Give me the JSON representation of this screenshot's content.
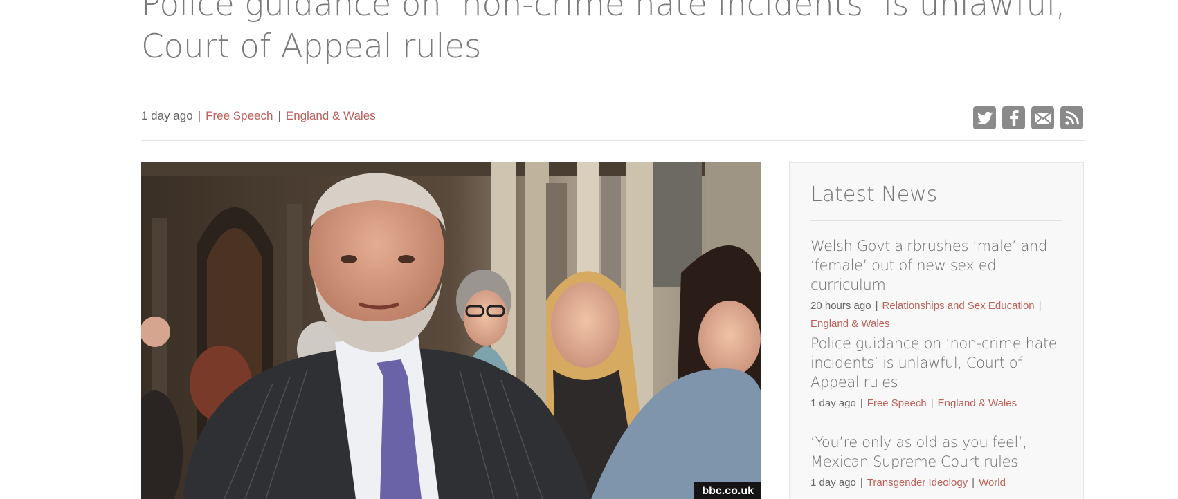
{
  "article": {
    "title": "Police guidance on ‘non-crime hate incidents’ is unlawful, Court of Appeal rules",
    "age": "1 day ago",
    "tags": [
      "Free Speech",
      "England & Wales"
    ],
    "separator": "|"
  },
  "share": {
    "buttons": [
      "twitter-icon",
      "facebook-icon",
      "email-icon",
      "rss-icon"
    ],
    "color": "#8a8a8a"
  },
  "hero_image": {
    "credit": "bbc.co.uk"
  },
  "sidebar": {
    "heading": "Latest News",
    "items": [
      {
        "title": "Welsh Govt airbrushes ‘male’ and ‘female’ out of new sex ed curriculum",
        "age": "20 hours ago",
        "tags": [
          "Relationships and Sex Education",
          "England & Wales"
        ]
      },
      {
        "title": "Police guidance on ‘non-crime hate incidents’ is unlawful, Court of Appeal rules",
        "age": "1 day ago",
        "tags": [
          "Free Speech",
          "England & Wales"
        ]
      },
      {
        "title": "‘You’re only as old as you feel’, Mexican Supreme Court rules",
        "age": "1 day ago",
        "tags": [
          "Transgender Ideology",
          "World"
        ]
      }
    ]
  },
  "colors": {
    "link": "#c0605a",
    "title": "#7a7a7a",
    "meta": "#666666"
  }
}
